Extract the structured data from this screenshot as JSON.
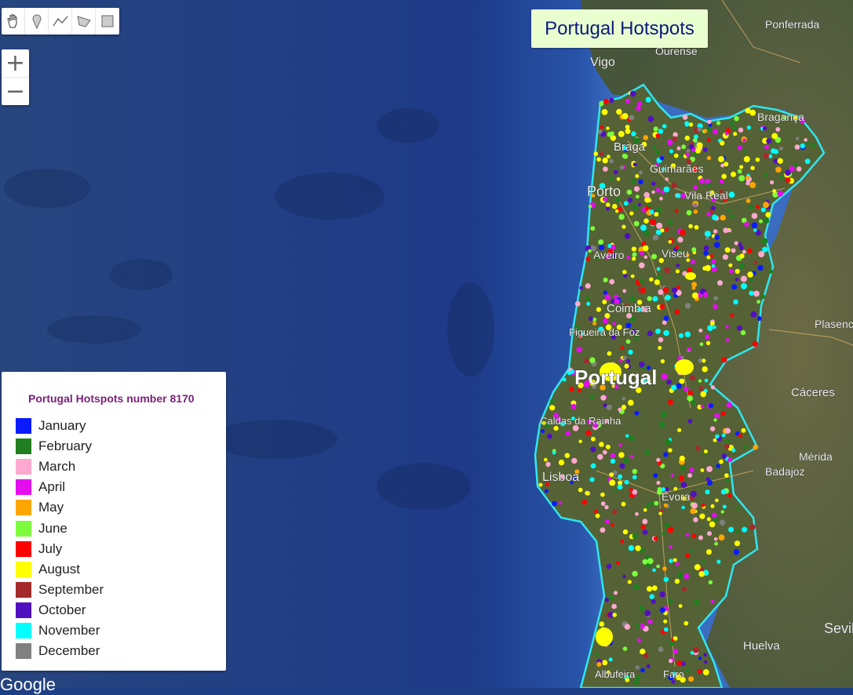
{
  "map": {
    "title": "Portugal Hotspots",
    "country_label": "Portugal",
    "cities": [
      {
        "name": "Ponferrada"
      },
      {
        "name": "Ourense"
      },
      {
        "name": "Vigo"
      },
      {
        "name": "Braga"
      },
      {
        "name": "Bragança"
      },
      {
        "name": "Guimarães"
      },
      {
        "name": "Porto"
      },
      {
        "name": "Vila Real"
      },
      {
        "name": "Aveiro"
      },
      {
        "name": "Viseu"
      },
      {
        "name": "Coimbra"
      },
      {
        "name": "Figueira da Foz"
      },
      {
        "name": "Plasencia"
      },
      {
        "name": "Cáceres"
      },
      {
        "name": "Caldas da Rainha"
      },
      {
        "name": "Lisboa"
      },
      {
        "name": "Mérida"
      },
      {
        "name": "Badajoz"
      },
      {
        "name": "Évora"
      },
      {
        "name": "Huelva"
      },
      {
        "name": "Albufeira"
      },
      {
        "name": "Faro"
      },
      {
        "name": "Sevilla"
      }
    ],
    "attribution": "Google",
    "colors": {
      "ocean": "#1e3f86",
      "land": "#4b5a35",
      "border": "#2ee6f0"
    }
  },
  "toolbar": {
    "tools": [
      {
        "icon": "hand-icon"
      },
      {
        "icon": "marker-icon"
      },
      {
        "icon": "line-icon"
      },
      {
        "icon": "polygon-icon"
      },
      {
        "icon": "rectangle-icon"
      }
    ]
  },
  "zoom": {
    "in_label": "+",
    "out_label": "−"
  },
  "legend": {
    "title": "Portugal Hotspots number 8170",
    "items": [
      {
        "label": "January",
        "color": "#0a1cff"
      },
      {
        "label": "February",
        "color": "#1f7f1f"
      },
      {
        "label": "March",
        "color": "#ffa8d0"
      },
      {
        "label": "April",
        "color": "#e40ef0"
      },
      {
        "label": "May",
        "color": "#ffa500"
      },
      {
        "label": "June",
        "color": "#7cfc3c"
      },
      {
        "label": "July",
        "color": "#ff0000"
      },
      {
        "label": "August",
        "color": "#ffff00"
      },
      {
        "label": "September",
        "color": "#a52a2a"
      },
      {
        "label": "October",
        "color": "#5010c0"
      },
      {
        "label": "November",
        "color": "#00ffff"
      },
      {
        "label": "December",
        "color": "#808080"
      }
    ]
  }
}
